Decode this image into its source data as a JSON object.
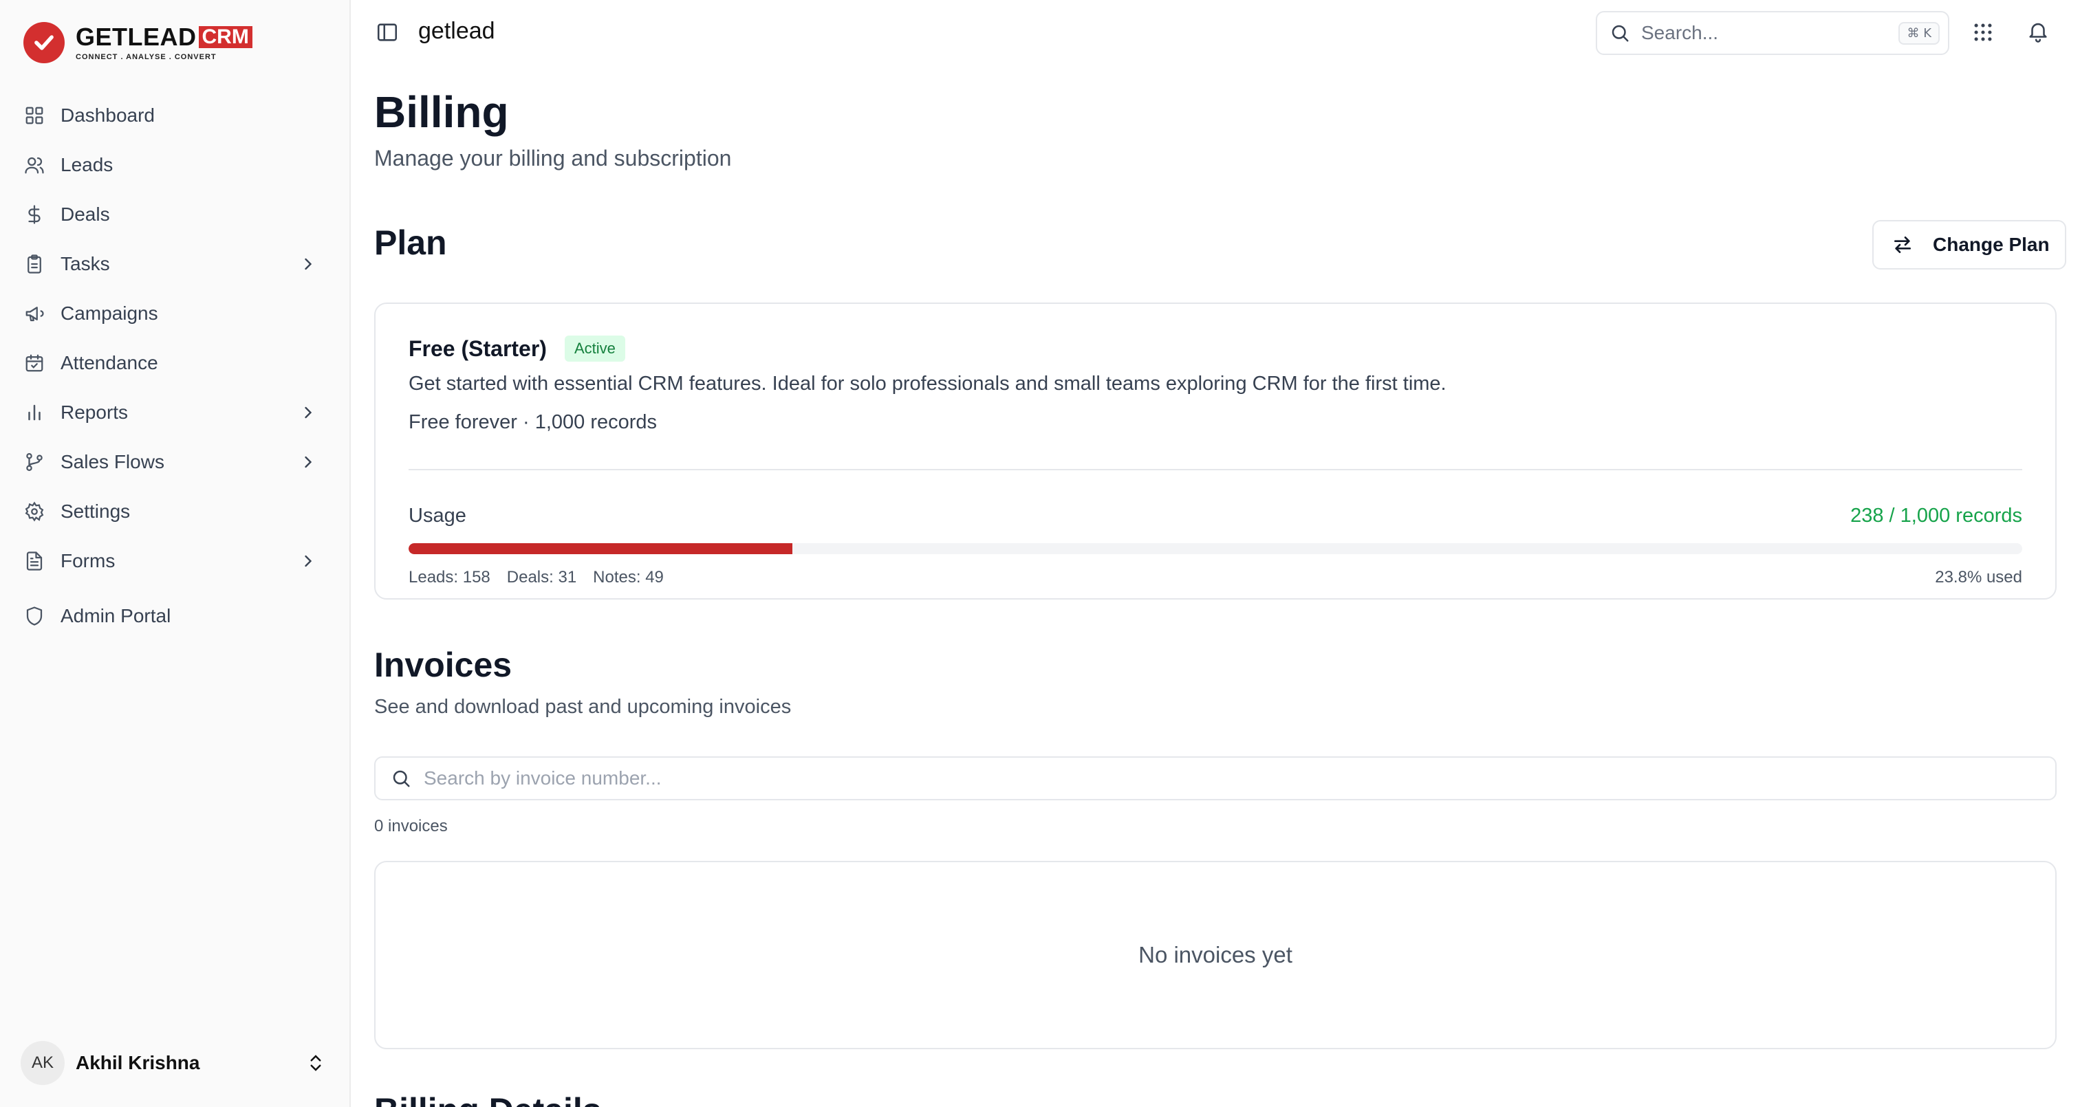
{
  "brand": {
    "name": "GETLEAD",
    "suffix": "CRM",
    "tagline": "CONNECT  .  ANALYSE  .  CONVERT",
    "accent": "#d32f2f"
  },
  "sidebar": {
    "items": [
      {
        "label": "Dashboard",
        "icon": "dashboard-icon",
        "expandable": false
      },
      {
        "label": "Leads",
        "icon": "users-icon",
        "expandable": false
      },
      {
        "label": "Deals",
        "icon": "dollar-icon",
        "expandable": false
      },
      {
        "label": "Tasks",
        "icon": "clipboard-icon",
        "expandable": true
      },
      {
        "label": "Campaigns",
        "icon": "megaphone-icon",
        "expandable": false
      },
      {
        "label": "Attendance",
        "icon": "calendar-check-icon",
        "expandable": false
      },
      {
        "label": "Reports",
        "icon": "bar-chart-icon",
        "expandable": true
      },
      {
        "label": "Sales Flows",
        "icon": "git-branch-icon",
        "expandable": true
      },
      {
        "label": "Settings",
        "icon": "gear-icon",
        "expandable": false
      },
      {
        "label": "Forms",
        "icon": "file-text-icon",
        "expandable": true
      }
    ],
    "admin": {
      "label": "Admin Portal",
      "icon": "shield-icon"
    },
    "user": {
      "initials": "AK",
      "name": "Akhil Krishna"
    }
  },
  "topbar": {
    "workspace": "getlead",
    "search_placeholder": "Search...",
    "search_shortcut": "⌘ K"
  },
  "page": {
    "title": "Billing",
    "subtitle": "Manage your billing and subscription"
  },
  "plan": {
    "section_title": "Plan",
    "change_button": "Change Plan",
    "name": "Free (Starter)",
    "status": "Active",
    "description": "Get started with essential CRM features. Ideal for solo professionals and small teams exploring CRM for the first time.",
    "price_line": "Free forever · 1,000 records",
    "usage": {
      "label": "Usage",
      "value_text": "238 / 1,000 records",
      "used": 238,
      "limit": 1000,
      "fraction": 0.238,
      "breakdown": [
        "Leads: 158",
        "Deals: 31",
        "Notes: 49"
      ],
      "percent_text": "23.8% used",
      "bar_color": "#c62828",
      "value_color": "#16a34a"
    }
  },
  "invoices": {
    "section_title": "Invoices",
    "subtitle": "See and download past and upcoming invoices",
    "search_placeholder": "Search by invoice number...",
    "count_text": "0 invoices",
    "empty_text": "No invoices yet"
  },
  "billing_details": {
    "section_title": "Billing Details"
  }
}
